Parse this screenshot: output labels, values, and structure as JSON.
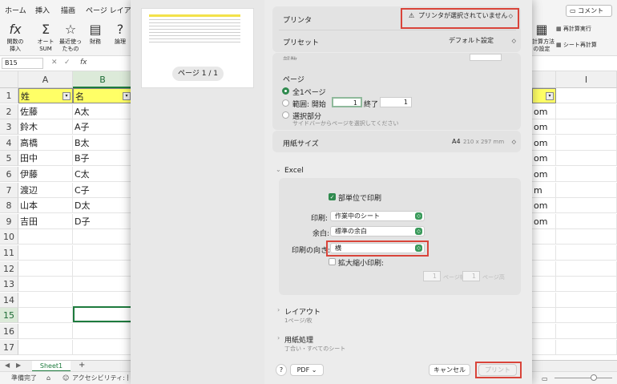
{
  "excel": {
    "tabs": [
      "ホーム",
      "挿入",
      "描画",
      "ページ レイアウ"
    ],
    "ribbon": {
      "function": "関数の\n挿入",
      "autosum": "オート\nSUM",
      "recent": "最近使っ\nたもの",
      "financial": "財務",
      "logical": "論理",
      "comment": "コメント",
      "recalc_now": "再計算実行",
      "recalc_options": "計算方法\nの設定",
      "recalc_sheet": "シート再計算"
    },
    "name_box": "B15",
    "fx": "fx",
    "columns": [
      "A",
      "B"
    ],
    "rows": [
      "1",
      "2",
      "3",
      "4",
      "5",
      "6",
      "7",
      "8",
      "9",
      "10",
      "11",
      "12",
      "13",
      "14",
      "15",
      "16",
      "17"
    ],
    "data": [
      [
        "姓",
        "名"
      ],
      [
        "佐藤",
        "A太"
      ],
      [
        "鈴木",
        "A子"
      ],
      [
        "高橋",
        "B太"
      ],
      [
        "田中",
        "B子"
      ],
      [
        "伊藤",
        "C太"
      ],
      [
        "渡辺",
        "C子"
      ],
      [
        "山本",
        "D太"
      ],
      [
        "吉田",
        "D子"
      ]
    ],
    "right_col_cells": [
      "om",
      "om",
      "om",
      "om",
      "om",
      "m",
      "om",
      "om"
    ],
    "right_col_head": "I",
    "sheet_tab": "Sheet1",
    "add_sheet": "+",
    "status_ready": "準備完了",
    "status_accessibility": "アクセシビリティ: 問題"
  },
  "dialog": {
    "page_indicator": "ページ 1 / 1",
    "printer_label": "プリンタ",
    "printer_value": "プリンタが選択されていません",
    "preset_label": "プリセット",
    "preset_value": "デフォルト設定",
    "copies_label": "部数",
    "pages_label": "ページ",
    "all_pages": "全1ページ",
    "range_label": "範囲: 開始",
    "range_from": "1",
    "range_to_label": "終了",
    "range_to": "1",
    "selection_label": "選択部分",
    "selection_hint": "サイドバーからページを選択してください",
    "paper_size_label": "用紙サイズ",
    "paper_size_value": "A4",
    "paper_size_dims": "210 x 297 mm",
    "excel_section": "Excel",
    "print_per_copy": "部単位で印刷",
    "print_label": "印刷:",
    "print_value": "作業中のシート",
    "margin_label": "余白:",
    "margin_value": "標準の余白",
    "orientation_label": "印刷の向き:",
    "orientation_value": "横",
    "scale_label": "拡大縮小印刷:",
    "scale_wide": "1",
    "scale_wide_unit": "ページ幅",
    "scale_tall": "1",
    "scale_tall_unit": "ページ高",
    "layout_label": "レイアウト",
    "layout_sub": "1ページ/枚",
    "paper_handling_label": "用紙処理",
    "paper_handling_sub": "丁合い・すべてのシート",
    "help": "?",
    "pdf": "PDF",
    "cancel": "キャンセル",
    "print": "プリント"
  },
  "colors": {
    "highlight": "#d9443a",
    "accent": "#2f8a4e",
    "header_fill": "#ffff66"
  }
}
